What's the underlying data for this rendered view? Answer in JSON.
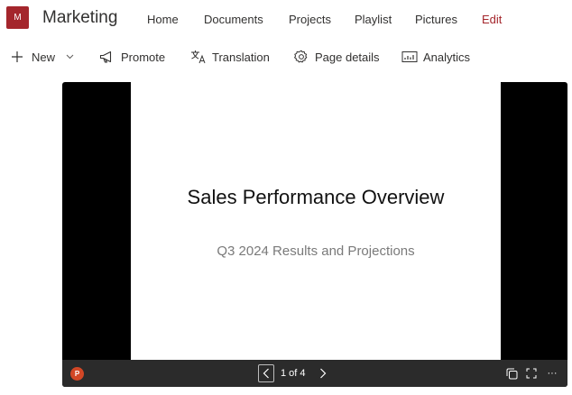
{
  "site": {
    "logo_letter": "M",
    "title": "Marketing",
    "brand_color": "#a4262c"
  },
  "nav": {
    "items": [
      {
        "label": "Home"
      },
      {
        "label": "Documents"
      },
      {
        "label": "Projects"
      },
      {
        "label": "Playlist"
      },
      {
        "label": "Pictures"
      },
      {
        "label": "Edit"
      }
    ]
  },
  "commands": {
    "new_label": "New",
    "promote_label": "Promote",
    "translation_label": "Translation",
    "page_details_label": "Page details",
    "analytics_label": "Analytics"
  },
  "viewer": {
    "slide_title": "Sales Performance Overview",
    "slide_subtitle": "Q3 2024 Results and Projections",
    "file_badge": "P",
    "page_counter": "1 of 4",
    "more_label": "···"
  }
}
